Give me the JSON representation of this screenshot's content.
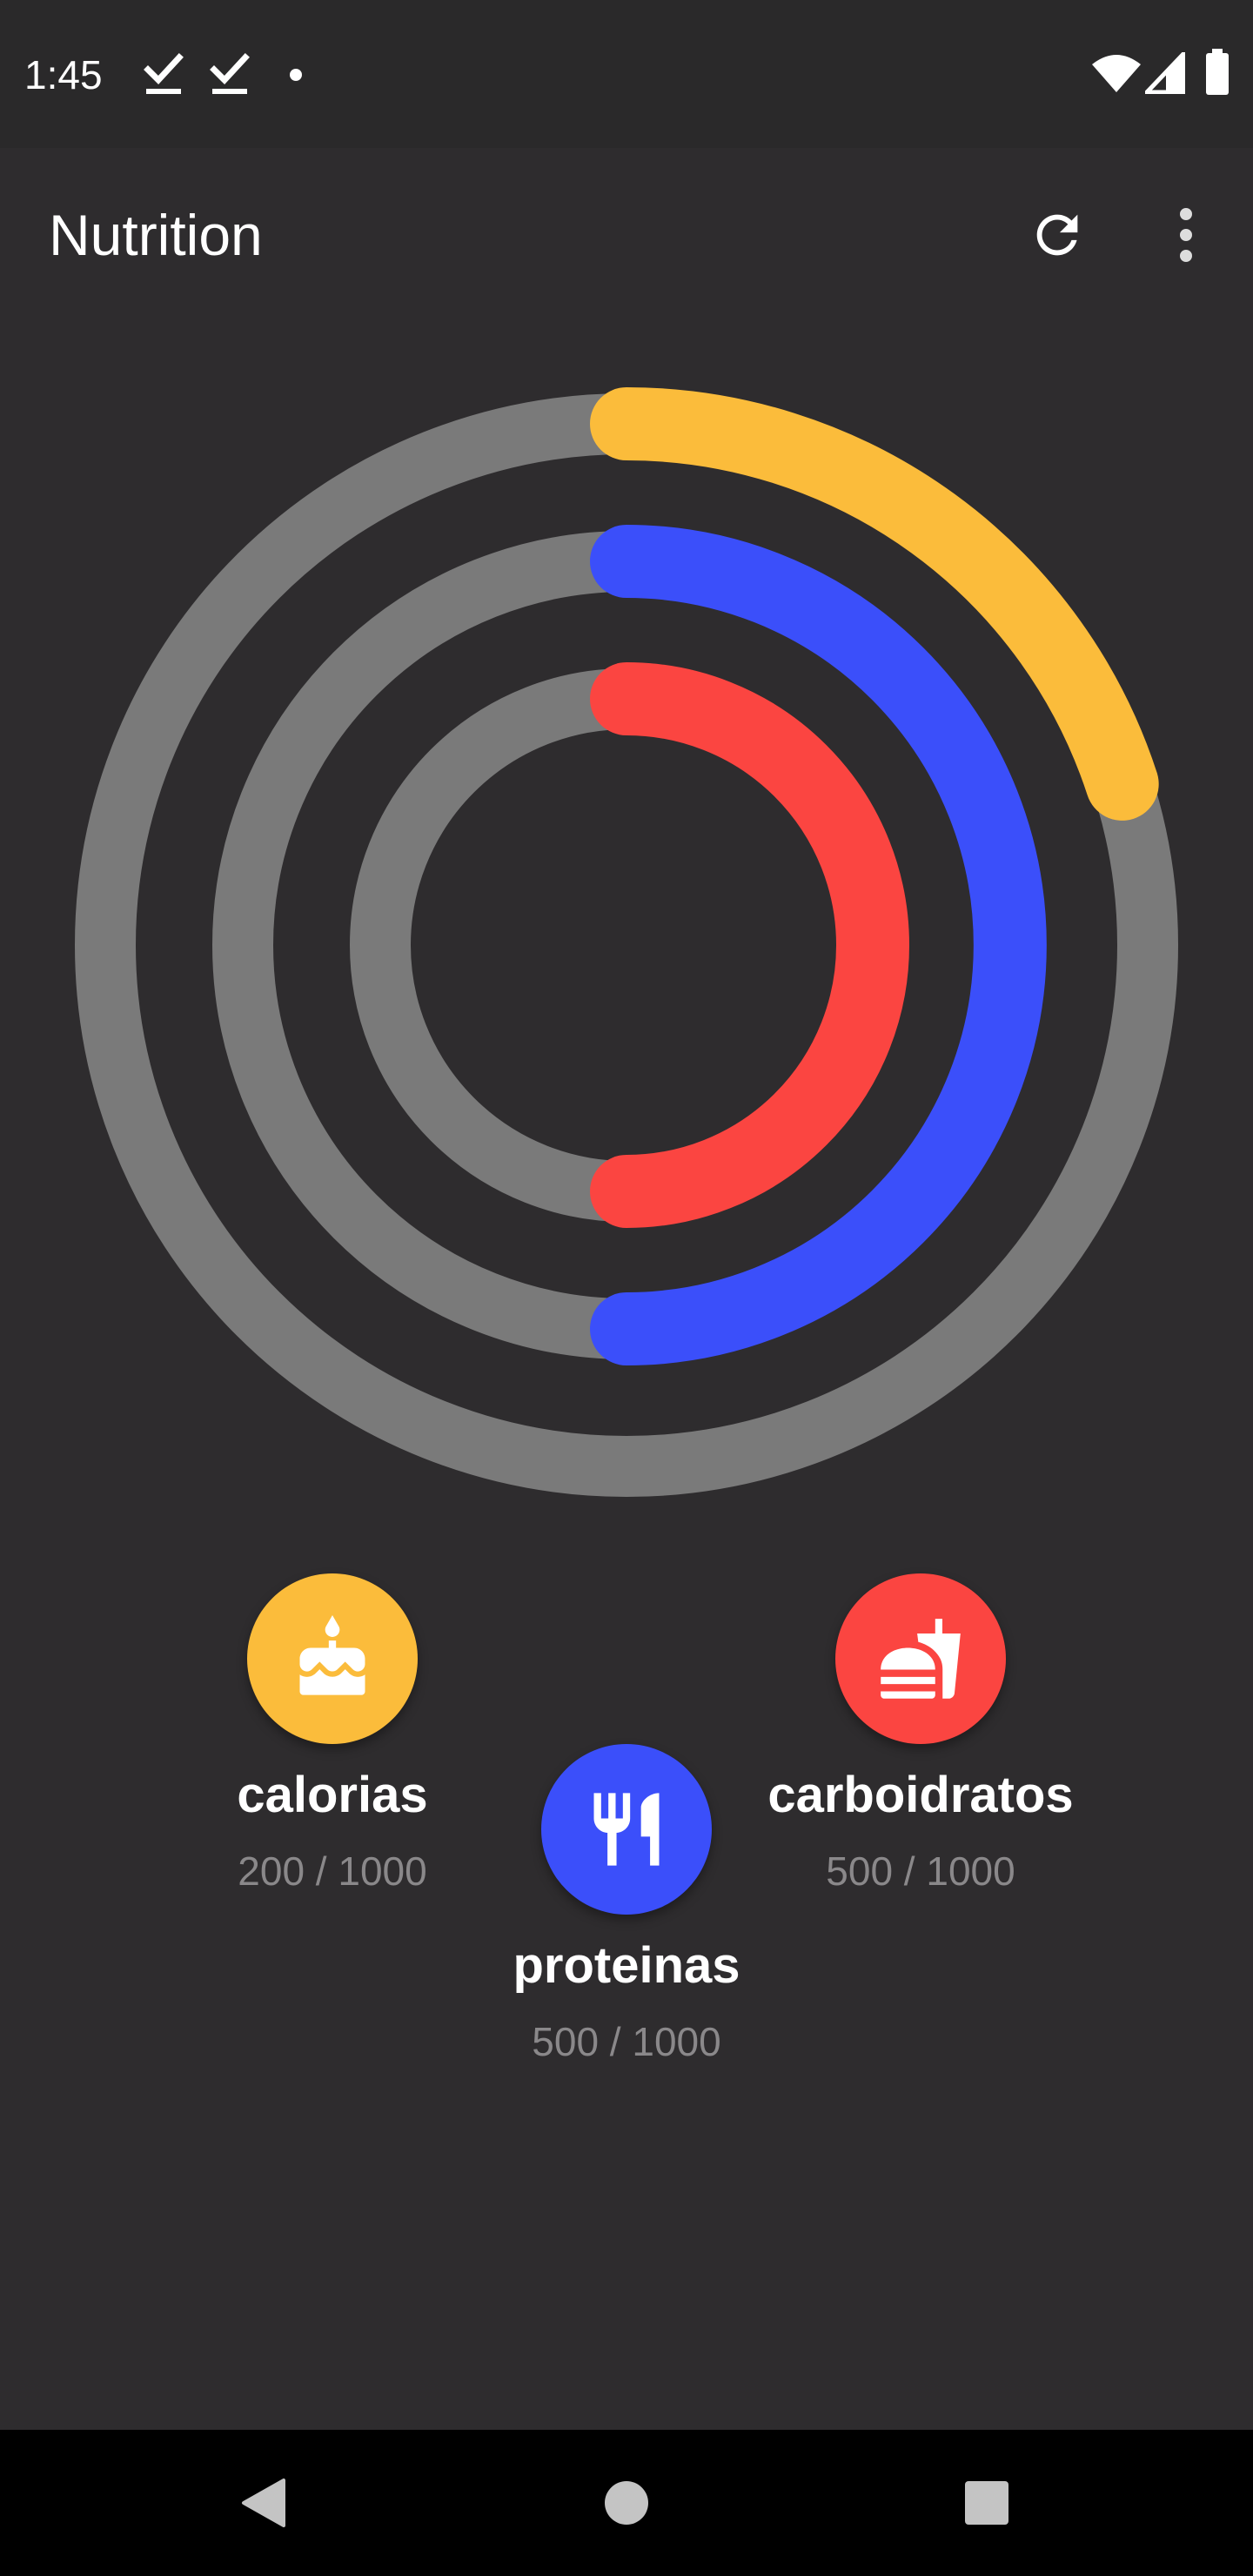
{
  "status_bar": {
    "time": "1:45",
    "icons": [
      "check-notification-icon",
      "check-notification-icon",
      "dot-icon",
      "wifi-icon",
      "signal-icon",
      "battery-icon"
    ]
  },
  "app_bar": {
    "title": "Nutrition",
    "actions": [
      "refresh-icon",
      "more-vert-icon"
    ]
  },
  "colors": {
    "background": "#2e2c2e",
    "track": "#7a7a7a",
    "calorias": "#fbbc3b",
    "proteinas": "#3b4ffa",
    "carboidratos": "#fb4541"
  },
  "nutrients": [
    {
      "key": "calorias",
      "label": "calorias",
      "value_text": "200 / 1000",
      "current": 200,
      "goal": 1000,
      "icon": "cake-icon",
      "color": "#fbbc3b"
    },
    {
      "key": "proteinas",
      "label": "proteinas",
      "value_text": "500 / 1000",
      "current": 500,
      "goal": 1000,
      "icon": "restaurant-icon",
      "color": "#3b4ffa"
    },
    {
      "key": "carboidratos",
      "label": "carboidratos",
      "value_text": "500 / 1000",
      "current": 500,
      "goal": 1000,
      "icon": "fastfood-icon",
      "color": "#fb4541"
    }
  ],
  "nav_bar": {
    "buttons": [
      "back-icon",
      "home-icon",
      "recents-icon"
    ]
  }
}
